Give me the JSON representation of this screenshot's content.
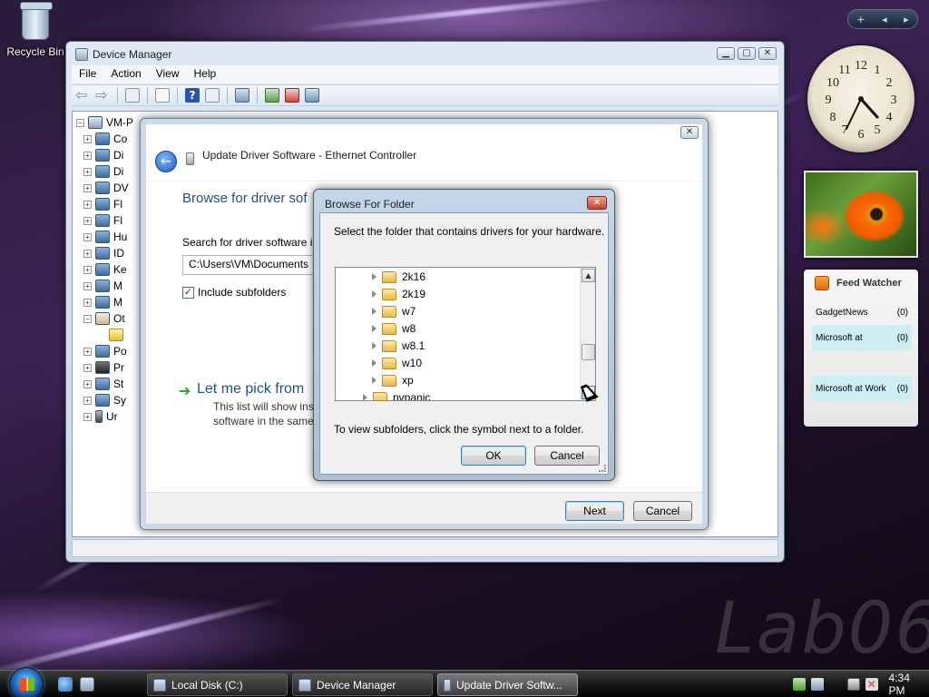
{
  "desktop": {
    "recycle_bin_label": "Recycle Bin",
    "watermark": "Lab06"
  },
  "device_manager": {
    "title": "Device Manager",
    "menu": [
      "File",
      "Action",
      "View",
      "Help"
    ],
    "tree": {
      "root": "VM-P",
      "rows": [
        {
          "label": "Co",
          "expanded": false
        },
        {
          "label": "Di",
          "expanded": false
        },
        {
          "label": "Di",
          "expanded": false
        },
        {
          "label": "DV",
          "expanded": false
        },
        {
          "label": "Fl",
          "expanded": false
        },
        {
          "label": "Fl",
          "expanded": false
        },
        {
          "label": "Hu",
          "expanded": false
        },
        {
          "label": "ID",
          "expanded": false
        },
        {
          "label": "Ke",
          "expanded": false
        },
        {
          "label": "M",
          "expanded": false
        },
        {
          "label": "M",
          "expanded": false
        },
        {
          "label": "Ot",
          "expanded": true
        },
        {
          "label": "",
          "expanded": false
        },
        {
          "label": "Po",
          "expanded": false
        },
        {
          "label": "Pr",
          "expanded": false
        },
        {
          "label": "St",
          "expanded": false
        },
        {
          "label": "Sy",
          "expanded": false
        },
        {
          "label": "Ur",
          "expanded": false
        }
      ]
    }
  },
  "update_driver": {
    "title": "Update Driver Software - Ethernet Controller",
    "heading": "Browse for driver sof",
    "search_label": "Search for driver software in",
    "path_value": "C:\\Users\\VM\\Documents",
    "include_subfolders_label": "Include subfolders",
    "include_subfolders_checked": true,
    "pick_heading": "Let me pick from",
    "pick_desc_line1": "This list will show inst",
    "pick_desc_line2": "software in the same",
    "next_label": "Next",
    "cancel_label": "Cancel"
  },
  "browse_folder": {
    "title": "Browse For Folder",
    "prompt": "Select the folder that contains drivers for your hardware.",
    "folders": [
      "2k16",
      "2k19",
      "w7",
      "w8",
      "w8.1",
      "w10",
      "xp",
      "pvpanic"
    ],
    "hint": "To view subfolders, click the symbol next to a folder.",
    "ok_label": "OK",
    "cancel_label": "Cancel"
  },
  "gadgets": {
    "feed_watcher_title": "Feed Watcher",
    "feeds": [
      {
        "name": "GadgetNews",
        "count": "(0)",
        "highlighted": false
      },
      {
        "name": "Microsoft at",
        "count": "(0)",
        "highlighted": true
      },
      {
        "name": "",
        "count": "",
        "highlighted": false
      },
      {
        "name": "Microsoft at Work",
        "count": "(0)",
        "highlighted": true
      }
    ],
    "clock_numbers": [
      "12",
      "1",
      "2",
      "3",
      "4",
      "5",
      "6",
      "7",
      "8",
      "9",
      "10",
      "11"
    ]
  },
  "taskbar": {
    "buttons": [
      {
        "label": "Local Disk (C:)",
        "active": false
      },
      {
        "label": "Device Manager",
        "active": false
      },
      {
        "label": "Update Driver Softw...",
        "active": true
      }
    ],
    "time": "4:34 PM"
  },
  "colors": {
    "heading_blue": "#1f4e8c",
    "feed_highlight": "#cdeef2",
    "default_button_border": "#3c7fb1"
  }
}
